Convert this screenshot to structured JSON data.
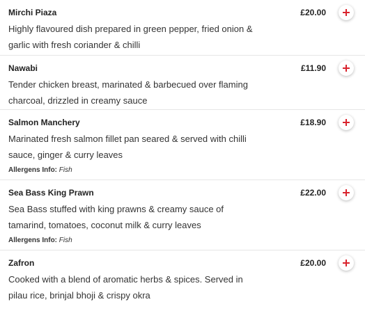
{
  "theme": {
    "accent": "#d9232d",
    "divider": "#e6e6e6"
  },
  "menu": {
    "allergens_label": "Allergens Info:",
    "add_icon": "plus-icon",
    "items": [
      {
        "name": "Mirchi Piaza",
        "price": "£20.00",
        "description": "Highly flavoured dish prepared in green pepper, fried onion & garlic with fresh coriander & chilli",
        "allergens": ""
      },
      {
        "name": "Nawabi",
        "price": "£11.90",
        "description": "Tender chicken breast, marinated & barbecued over flaming charcoal, drizzled in creamy sauce",
        "allergens": ""
      },
      {
        "name": "Salmon Manchery",
        "price": "£18.90",
        "description": "Marinated fresh salmon fillet pan seared & served with chilli sauce, ginger & curry leaves",
        "allergens": "Fish"
      },
      {
        "name": "Sea Bass King Prawn",
        "price": "£22.00",
        "description": "Sea Bass stuffed with king prawns & creamy sauce of tamarind, tomatoes, coconut milk & curry leaves",
        "allergens": "Fish"
      },
      {
        "name": "Zafron",
        "price": "£20.00",
        "description": "Cooked with a blend of aromatic herbs & spices. Served in pilau rice, brinjal bhoji & crispy okra",
        "allergens": ""
      }
    ]
  }
}
